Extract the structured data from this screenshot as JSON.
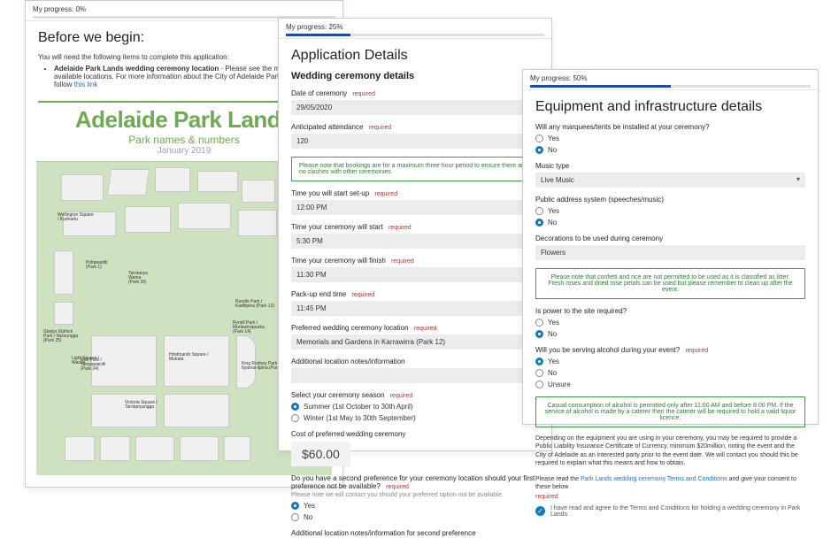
{
  "card1": {
    "progress_label": "My progress: 0%",
    "progress_pct": 0,
    "heading": "Before we begin:",
    "intro": "You will need the following items to complete this application:",
    "bullet_strong": "Adelaide Park Lands wedding ceremony location",
    "bullet_rest": " - Please see the map below for available locations. For more information about the City of Adelaide Park Lands, please follow ",
    "bullet_link": "this link",
    "map_title": "Adelaide Park Lands",
    "map_sub": "Park names & numbers",
    "map_date": "January 2019"
  },
  "card2": {
    "progress_label": "My progress: 25%",
    "progress_pct": 25,
    "heading": "Application Details",
    "subheading": "Wedding ceremony details",
    "date_label": "Date of ceremony",
    "date_value": "29/05/2020",
    "attend_label": "Anticipated attendance",
    "attend_value": "120",
    "notice1": "Please note that bookings are for a maximum three hour period to ensure there are no clashes with other ceremonies",
    "setup_label": "Time you will start set-up",
    "setup_value": "12:00 PM",
    "start_label": "Time your ceremony will start",
    "start_value": "5:30 PM",
    "finish_label": "Time your ceremony will finish",
    "finish_value": "11:30 PM",
    "packup_label": "Pack-up end time",
    "packup_value": "11:45 PM",
    "location_label": "Preferred wedding ceremony location",
    "location_value": "Memorials and Gardens in Karrawirra (Park 12)",
    "addl_label": "Additional location notes/information",
    "season_label": "Select your ceremony season",
    "season_summer": "Summer (1st October to 30th April)",
    "season_winter": "Winter (1st May to 30th September)",
    "cost_label": "Cost of preferred wedding ceremony",
    "cost_value": "$60.00",
    "second_pref_question": "Do you have a second preference for your ceremony location should your first preference not be available?",
    "second_pref_hint": "Please note we will contact you should your preferred option not be available.",
    "yes": "Yes",
    "no": "No",
    "addl2_label": "Additional location notes/information for second preference",
    "required": "required"
  },
  "card3": {
    "progress_label": "My progress: 50%",
    "progress_pct": 50,
    "heading": "Equipment and infrastructure details",
    "marquee_q": "Will any marquees/tents be installed at your ceremony?",
    "yes": "Yes",
    "no": "No",
    "unsure": "Unsure",
    "music_label": "Music type",
    "music_value": "Live Music",
    "pa_q": "Public address system (speeches/music)",
    "deco_label": "Decorations to be used during ceremony",
    "deco_value": "Flowers",
    "notice_deco": "Please note that confetti and rice are not permitted to be used as it is classified as litter. Fresh roses and dried rose petals can be used but please remember to clean up after the event.",
    "power_q": "Is power to the site required?",
    "alcohol_q": "Will you be serving alcohol during your event?",
    "notice_alcohol": "Casual consumption of alcohol is permitted only after 11:00 AM and before 8:00 PM. If the service of alcohol is made by a caterer then the caterer will be required to hold a valid liquor licence.",
    "liability_text": "Depending on the equipment you are using in your ceremony, you may be required to provide a Public Liability Insurance Certificate of Currency, minimum $20million, noting the event and the City of Adelaide as an interested party prior to the event date. We will contact you should this be required to explain what this means and how to obtain.",
    "terms_preface": "Please read the ",
    "terms_link": "Park Lands wedding ceremony Terms and Conditions",
    "terms_suffix": " and give your consent to these below",
    "required": "required",
    "agree_text": "I have read and agree to the Terms and Conditions for holding a wedding ceremony in Park Lands"
  }
}
